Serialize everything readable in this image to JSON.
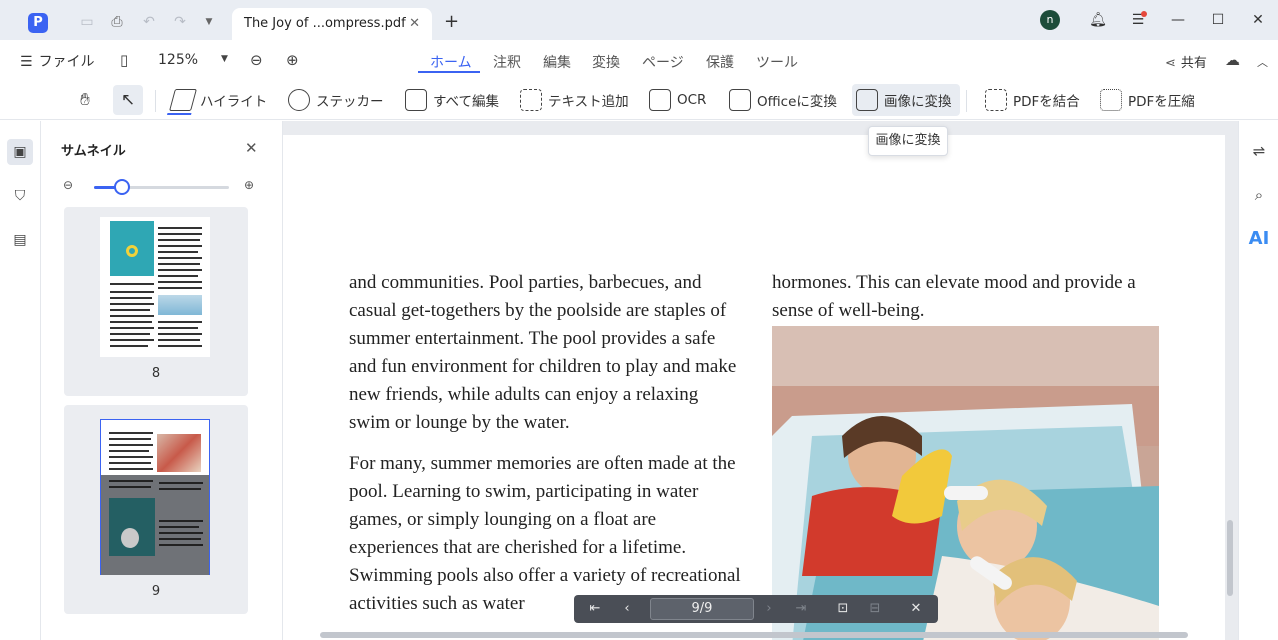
{
  "titlebar": {
    "tab_title": "The Joy of ...ompress.pdf",
    "avatar_initial": "n",
    "icons": [
      "app-logo",
      "save-icon",
      "print-icon",
      "undo-icon",
      "redo-icon",
      "dropdown-icon",
      "close-icon",
      "plus-icon",
      "bell-icon",
      "menu-icon",
      "minimize-icon",
      "maximize-icon",
      "window-close-icon"
    ]
  },
  "menubar": {
    "file_label": "ファイル",
    "zoom": "125%",
    "tabs": [
      {
        "label": "ホーム",
        "active": true
      },
      {
        "label": "注釈",
        "active": false
      },
      {
        "label": "編集",
        "active": false
      },
      {
        "label": "変換",
        "active": false
      },
      {
        "label": "ページ",
        "active": false
      },
      {
        "label": "保護",
        "active": false
      },
      {
        "label": "ツール",
        "active": false
      }
    ],
    "share_label": "共有"
  },
  "toolbar": {
    "tools": [
      {
        "label": "ハイライト"
      },
      {
        "label": "ステッカー"
      },
      {
        "label": "すべて編集"
      },
      {
        "label": "テキスト追加"
      },
      {
        "label": "OCR"
      },
      {
        "label": "Officeに変換"
      },
      {
        "label": "画像に変換"
      },
      {
        "label": "PDFを結合"
      },
      {
        "label": "PDFを圧縮"
      }
    ],
    "tooltip": "画像に変換"
  },
  "thumbnails": {
    "title": "サムネイル",
    "zoom_fraction": 0.21,
    "pages": [
      {
        "number": "8"
      },
      {
        "number": "9"
      }
    ]
  },
  "document": {
    "left_paragraphs": [
      "and communities. Pool parties, barbecues, and casual get-togethers by the poolside are staples of summer entertainment. The pool provides a safe and fun environment for children to play and make new friends, while adults can enjoy a relaxing swim or lounge by the water.",
      "For many, summer memories are often made at the pool. Learning to swim, participating in water games, or simply lounging on a float are experiences that are cherished for a lifetime. Swimming pools also offer a variety of recreational activities such as water"
    ],
    "right_paragraph": "hormones. This can elevate mood and provide a sense of well-being."
  },
  "pagenav": {
    "page_indicator": "9/9"
  },
  "colors": {
    "accent": "#3b63f2",
    "titlebar_bg": "#e9edf3",
    "avatar_bg": "#1d4d3a",
    "ai_blue": "#3b8cf2"
  }
}
